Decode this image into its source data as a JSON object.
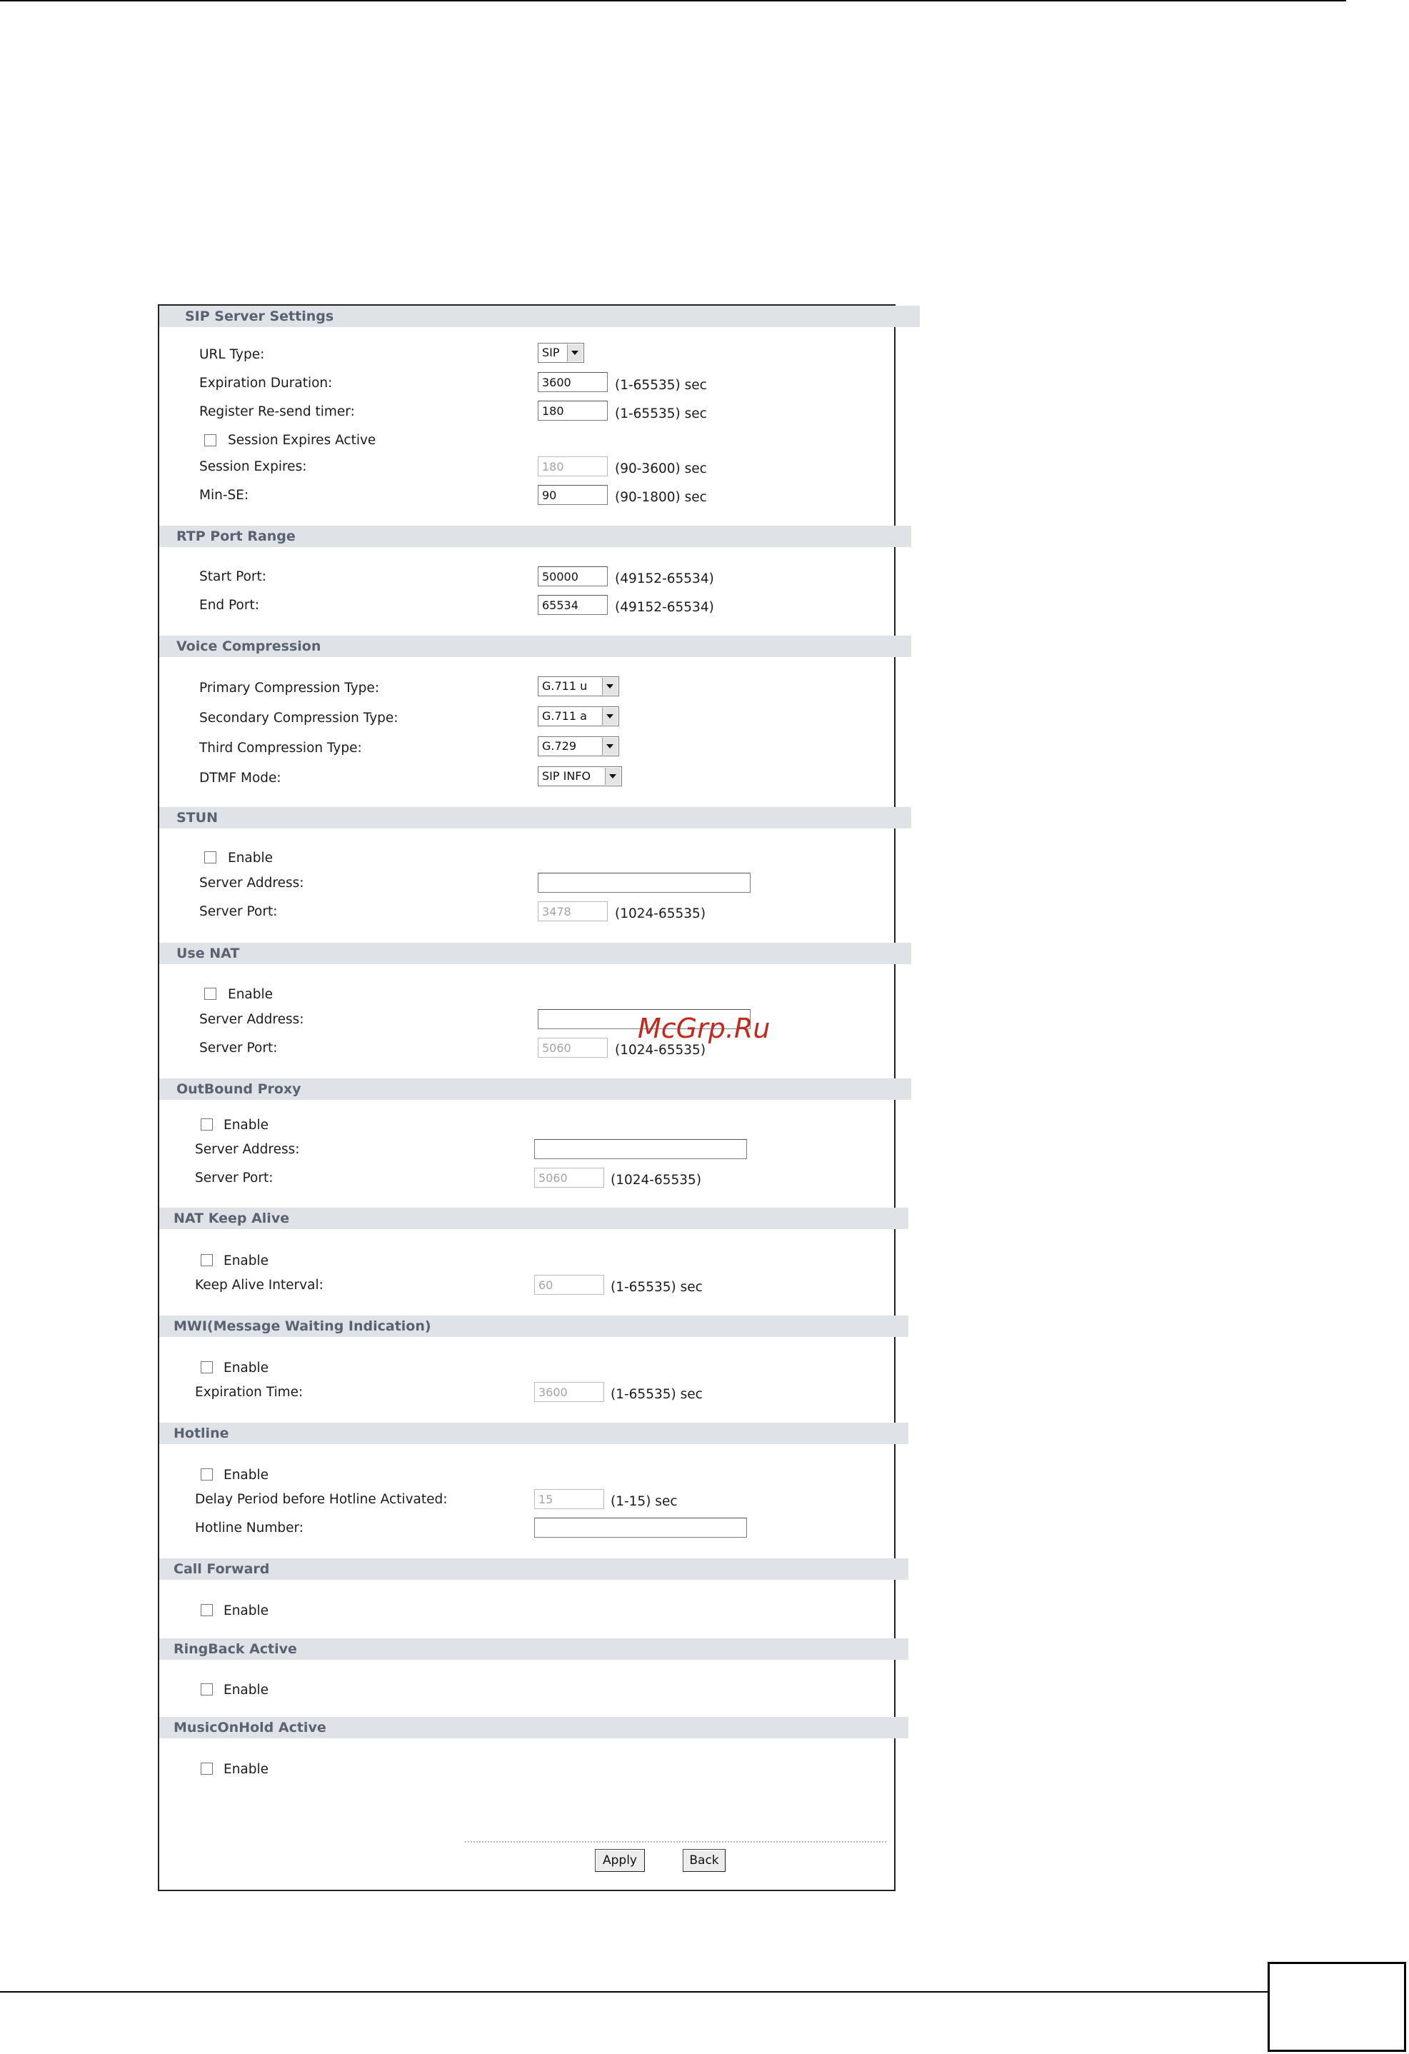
{
  "sip_server": {
    "header": "SIP Server Settings",
    "url_type_label": "URL Type:",
    "url_type_value": "SIP",
    "expiration_label": "Expiration Duration:",
    "expiration_value": "3600",
    "expiration_hint": "(1-65535) sec",
    "resend_label": "Register Re-send timer:",
    "resend_value": "180",
    "resend_hint": "(1-65535) sec",
    "session_active_label": "Session Expires Active",
    "session_expires_label": "Session Expires:",
    "session_expires_value": "180",
    "session_expires_hint": "(90-3600) sec",
    "min_se_label": "Min-SE:",
    "min_se_value": "90",
    "min_se_hint": "(90-1800) sec"
  },
  "rtp": {
    "header": "RTP Port Range",
    "start_label": "Start Port:",
    "start_value": "50000",
    "start_hint": "(49152-65534)",
    "end_label": "End Port:",
    "end_value": "65534",
    "end_hint": "(49152-65534)"
  },
  "voice": {
    "header": "Voice Compression",
    "primary_label": "Primary Compression Type:",
    "primary_value": "G.711 u",
    "secondary_label": "Secondary Compression Type:",
    "secondary_value": "G.711 a",
    "third_label": "Third Compression Type:",
    "third_value": "G.729",
    "dtmf_label": "DTMF Mode:",
    "dtmf_value": "SIP INFO"
  },
  "stun": {
    "header": "STUN",
    "enable_label": "Enable",
    "address_label": "Server Address:",
    "address_value": "",
    "port_label": "Server Port:",
    "port_value": "3478",
    "port_hint": "(1024-65535)"
  },
  "nat": {
    "header": "Use NAT",
    "enable_label": "Enable",
    "address_label": "Server Address:",
    "address_value": "",
    "port_label": "Server Port:",
    "port_value": "5060",
    "port_hint": "(1024-65535)"
  },
  "proxy": {
    "header": "OutBound Proxy",
    "enable_label": "Enable",
    "address_label": "Server Address:",
    "address_value": "",
    "port_label": "Server Port:",
    "port_value": "5060",
    "port_hint": "(1024-65535)"
  },
  "keepalive": {
    "header": "NAT Keep Alive",
    "enable_label": "Enable",
    "interval_label": "Keep Alive Interval:",
    "interval_value": "60",
    "interval_hint": "(1-65535) sec"
  },
  "mwi": {
    "header": "MWI(Message Waiting Indication)",
    "enable_label": "Enable",
    "expiration_label": "Expiration Time:",
    "expiration_value": "3600",
    "expiration_hint": "(1-65535) sec"
  },
  "hotline": {
    "header": "Hotline",
    "enable_label": "Enable",
    "delay_label": "Delay Period before Hotline Activated:",
    "delay_value": "15",
    "delay_hint": "(1-15) sec",
    "number_label": "Hotline Number:",
    "number_value": ""
  },
  "call_forward": {
    "header": "Call Forward",
    "enable_label": "Enable"
  },
  "ringback": {
    "header": "RingBack Active",
    "enable_label": "Enable"
  },
  "music": {
    "header": "MusicOnHold Active",
    "enable_label": "Enable"
  },
  "buttons": {
    "apply": "Apply",
    "back": "Back"
  },
  "watermark": "McGrp.Ru"
}
